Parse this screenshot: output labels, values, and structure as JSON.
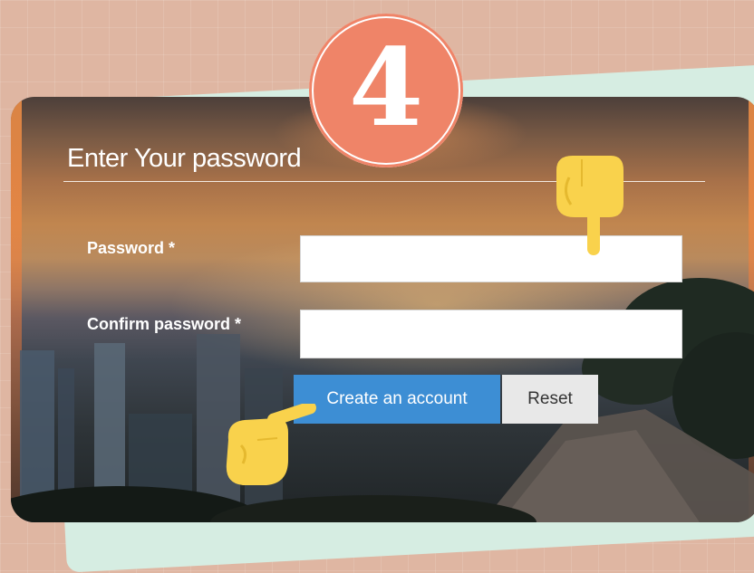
{
  "step_badge": {
    "number": "4"
  },
  "form": {
    "legend": "Enter Your password",
    "password_label": "Password *",
    "password_value": "",
    "confirm_label": "Confirm password *",
    "confirm_value": ""
  },
  "buttons": {
    "create_account": "Create an account",
    "reset": "Reset"
  },
  "icons": {
    "pointer_down": "hand-pointing-down-icon",
    "pointer_right": "hand-pointing-right-icon"
  },
  "colors": {
    "background": "#dfb6a2",
    "badge": "#ef8468",
    "primary_button": "#3d8ed4",
    "reset_button": "#e8e8e8",
    "hand": "#f9d24c"
  }
}
